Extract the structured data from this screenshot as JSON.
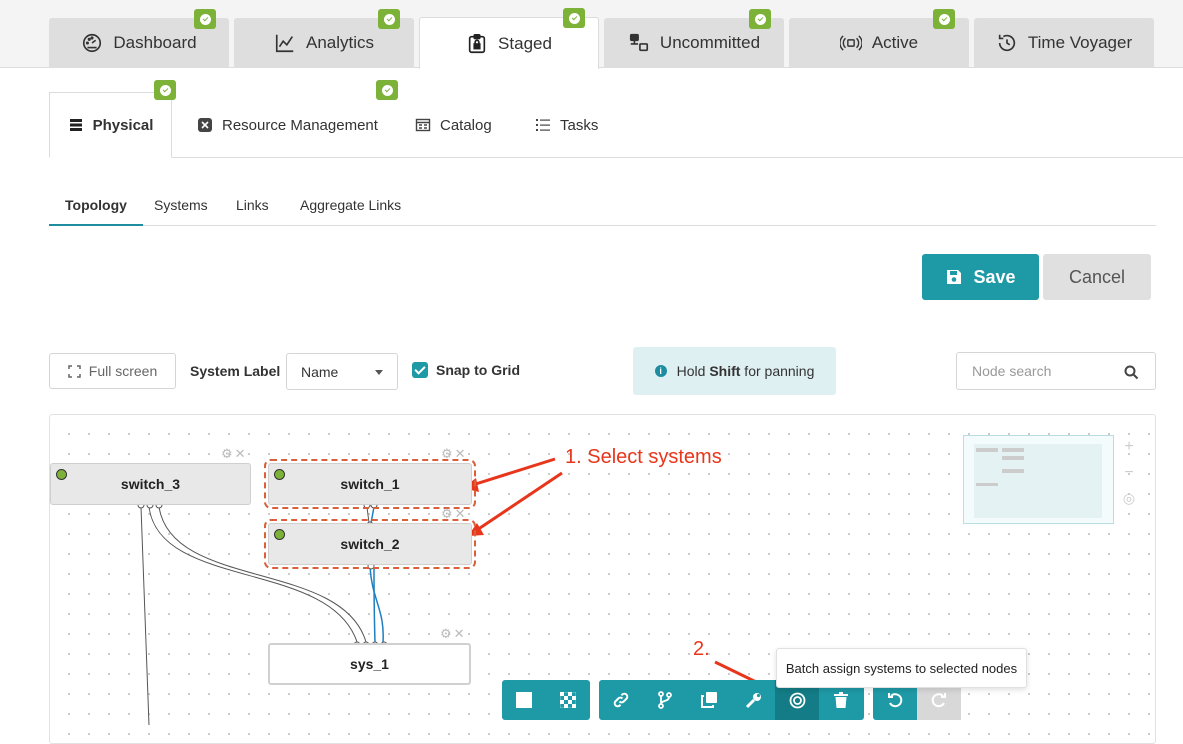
{
  "top_tabs": [
    {
      "label": "Dashboard",
      "icon": "gauge-icon",
      "badge": true
    },
    {
      "label": "Analytics",
      "icon": "line-chart-icon",
      "badge": true
    },
    {
      "label": "Staged",
      "icon": "clipboard-lock-icon",
      "badge": true,
      "active": true
    },
    {
      "label": "Uncommitted",
      "icon": "uncommitted-icon",
      "badge": true
    },
    {
      "label": "Active",
      "icon": "active-signal-icon",
      "badge": true
    },
    {
      "label": "Time Voyager",
      "icon": "history-icon",
      "badge": false
    }
  ],
  "sub_tabs": [
    {
      "label": "Physical",
      "icon": "server-icon",
      "badge": true,
      "active": true
    },
    {
      "label": "Resource Management",
      "icon": "resource-icon",
      "badge": true
    },
    {
      "label": "Catalog",
      "icon": "catalog-icon",
      "badge": false
    },
    {
      "label": "Tasks",
      "icon": "list-icon",
      "badge": false
    }
  ],
  "view_tabs": [
    {
      "label": "Topology",
      "active": true
    },
    {
      "label": "Systems"
    },
    {
      "label": "Links"
    },
    {
      "label": "Aggregate Links"
    }
  ],
  "actions": {
    "save": "Save",
    "cancel": "Cancel"
  },
  "toolbar": {
    "fullscreen": "Full screen",
    "system_label": "System Label",
    "system_label_value": "Name",
    "snap_to_grid": "Snap to Grid",
    "snap_checked": true,
    "hint_prefix": "Hold ",
    "hint_key": "Shift",
    "hint_suffix": " for panning",
    "search_placeholder": "Node search"
  },
  "nodes": [
    {
      "name": "switch_3",
      "status": "green"
    },
    {
      "name": "switch_1",
      "status": "green",
      "selected": true
    },
    {
      "name": "switch_2",
      "status": "green",
      "selected": true
    },
    {
      "name": "sys_1"
    }
  ],
  "annotations": {
    "step1": "1. Select systems",
    "step2": "2."
  },
  "tooltip": "Batch assign systems to selected nodes",
  "colors": {
    "accent": "#1e9aa6",
    "badge": "#7db238",
    "annotation": "#e8361c",
    "selection": "#d9603b"
  }
}
